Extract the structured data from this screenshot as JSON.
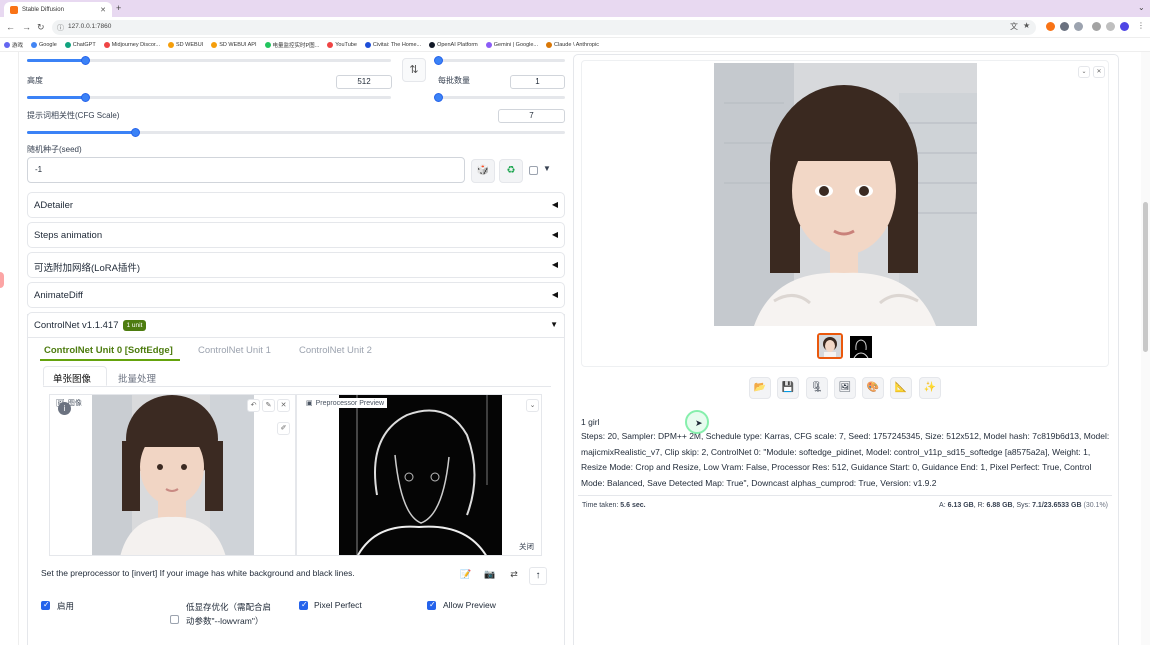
{
  "browser": {
    "tab_title": "Stable Diffusion",
    "url": "127.0.0.1:7860",
    "bookmarks": [
      {
        "label": "游戏",
        "color": "#6366f1"
      },
      {
        "label": "Google",
        "color": "#4285f4"
      },
      {
        "label": "ChatGPT",
        "color": "#10a37f"
      },
      {
        "label": "Midjourney Discor...",
        "color": "#ef4444"
      },
      {
        "label": "SD WEBUI",
        "color": "#f59e0b"
      },
      {
        "label": "SD WEBUI API",
        "color": "#f59e0b"
      },
      {
        "label": "电量监控实时P图...",
        "color": "#22c55e"
      },
      {
        "label": "YouTube",
        "color": "#ef4444"
      },
      {
        "label": "Civitai: The Home...",
        "color": "#1d4ed8"
      },
      {
        "label": "OpenAI Platform",
        "color": "#111827"
      },
      {
        "label": "Gemini | Google...",
        "color": "#8b5cf6"
      },
      {
        "label": "Claude \\ Anthropic",
        "color": "#d97706"
      }
    ]
  },
  "params": {
    "height_label": "高度",
    "height_value": "512",
    "batch_size_label": "每批数量",
    "batch_size_value": "1",
    "cfg_label": "提示词相关性(CFG Scale)",
    "cfg_value": "7",
    "seed_label": "随机种子(seed)",
    "seed_value": "-1",
    "width_slider_fraction": 0.16,
    "height_slider_fraction": 0.16,
    "batch_count_slider_fraction": 0.0,
    "batch_size_slider_fraction": 0.0,
    "cfg_slider_fraction": 0.2
  },
  "accordions": [
    {
      "label": "ADetailer",
      "arrow": "◀"
    },
    {
      "label": "Steps animation",
      "arrow": "◀"
    },
    {
      "label": "可选附加网络(LoRA插件)",
      "arrow": "◀"
    },
    {
      "label": "AnimateDiff",
      "arrow": "◀"
    }
  ],
  "controlnet": {
    "title": "ControlNet v1.1.417",
    "badge": "1 unit",
    "arrow": "▼",
    "units": [
      "ControlNet Unit 0 [SoftEdge]",
      "ControlNet Unit 1",
      "ControlNet Unit 2"
    ],
    "subtabs": [
      "单张图像",
      "批量处理"
    ],
    "image_tag": "图像",
    "preview_tag": "Preprocessor Preview",
    "close_label": "关闭",
    "hint": "Set the preprocessor to [invert] If your image has white background and black lines.",
    "options": [
      {
        "label": "启用",
        "checked": true
      },
      {
        "label": "低显存优化（需配合启动参数\"--lowvram\"）",
        "checked": false
      },
      {
        "label": "Pixel Perfect",
        "checked": true
      },
      {
        "label": "Allow Preview",
        "checked": true
      }
    ]
  },
  "output": {
    "prompt": "1 girl",
    "params": "Steps: 20, Sampler: DPM++ 2M, Schedule type: Karras, CFG scale: 7, Seed: 1757245345, Size: 512x512, Model hash: 7c819b6d13, Model: majicmixRealistic_v7, Clip skip: 2, ControlNet 0: \"Module: softedge_pidinet, Model: control_v11p_sd15_softedge [a8575a2a], Weight: 1, Resize Mode: Crop and Resize, Low Vram: False, Processor Res: 512, Guidance Start: 0, Guidance End: 1, Pixel Perfect: True, Control Mode: Balanced, Save Detected Map: True\", Downcast alphas_cumprod: True, Version: v1.9.2",
    "time_label": "Time taken:",
    "time_value": "5.6 sec.",
    "vram_a_label": "A:",
    "vram_a": "6.13 GB",
    "vram_r_label": "R:",
    "vram_r": "6.88 GB",
    "vram_sys_label": "Sys:",
    "vram_sys": "7.1/23.6533 GB",
    "vram_pct": "(30.1%)"
  },
  "icons": {
    "swap": "⇅",
    "dice": "🎲",
    "recycle": "♻",
    "dropdown": "▼",
    "folder": "📂",
    "save": "💾",
    "zip": "🗜",
    "image": "🖼",
    "palette": "🎨",
    "ruler": "📐",
    "sparkle": "✨",
    "edit": "📝",
    "camera": "📷",
    "swap2": "⇄",
    "up": "🡑"
  }
}
